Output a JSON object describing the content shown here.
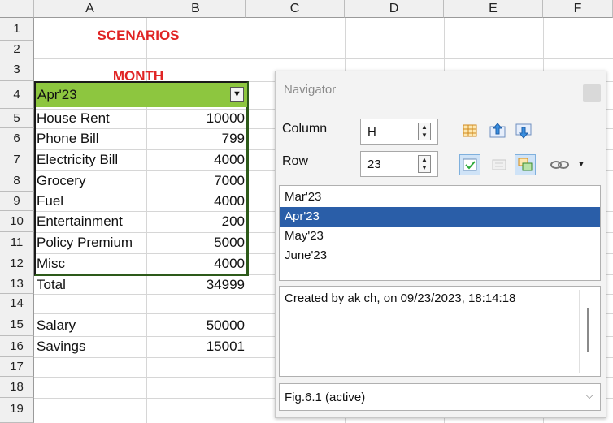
{
  "sheet": {
    "columns": [
      "A",
      "B",
      "C",
      "D",
      "E",
      "F"
    ],
    "rows": [
      "1",
      "2",
      "3",
      "4",
      "5",
      "6",
      "7",
      "8",
      "9",
      "10",
      "11",
      "12",
      "13",
      "14",
      "15",
      "16",
      "17",
      "18",
      "19"
    ],
    "cells": {
      "A1": "SCENARIOS",
      "A3": "MONTH",
      "A4": "Apr'23",
      "A5": "House Rent",
      "B5": "10000",
      "A6": "Phone Bill",
      "B6": "799",
      "A7": "Electricity Bill",
      "B7": "4000",
      "A8": "Grocery",
      "B8": "7000",
      "A9": "Fuel",
      "B9": "4000",
      "A10": "Entertainment",
      "B10": "200",
      "A11": "Policy Premium",
      "B11": "5000",
      "A12": "Misc",
      "B12": "4000",
      "A13": "Total",
      "B13": "34999",
      "A15": "Salary",
      "B15": "50000",
      "A16": "Savings",
      "B16": "15001"
    },
    "scenario_color": "#8dc63f",
    "header_red": "#e02424"
  },
  "navigator": {
    "title": "Navigator",
    "column_label": "Column",
    "column_value": "H",
    "row_label": "Row",
    "row_value": "23",
    "scenarios": [
      "Mar'23",
      "Apr'23",
      "May'23",
      "June'23"
    ],
    "selected_index": 1,
    "comment": "Created by ak ch, on 09/23/2023, 18:14:18",
    "document": "Fig.6.1 (active)",
    "toolbar_icons": [
      "data-range-icon",
      "start-icon",
      "end-icon",
      "toggle-icon",
      "contents-icon",
      "scenarios-icon",
      "drag-mode-icon",
      "dropdown-icon"
    ],
    "selection_color": "#2a5ea8"
  }
}
